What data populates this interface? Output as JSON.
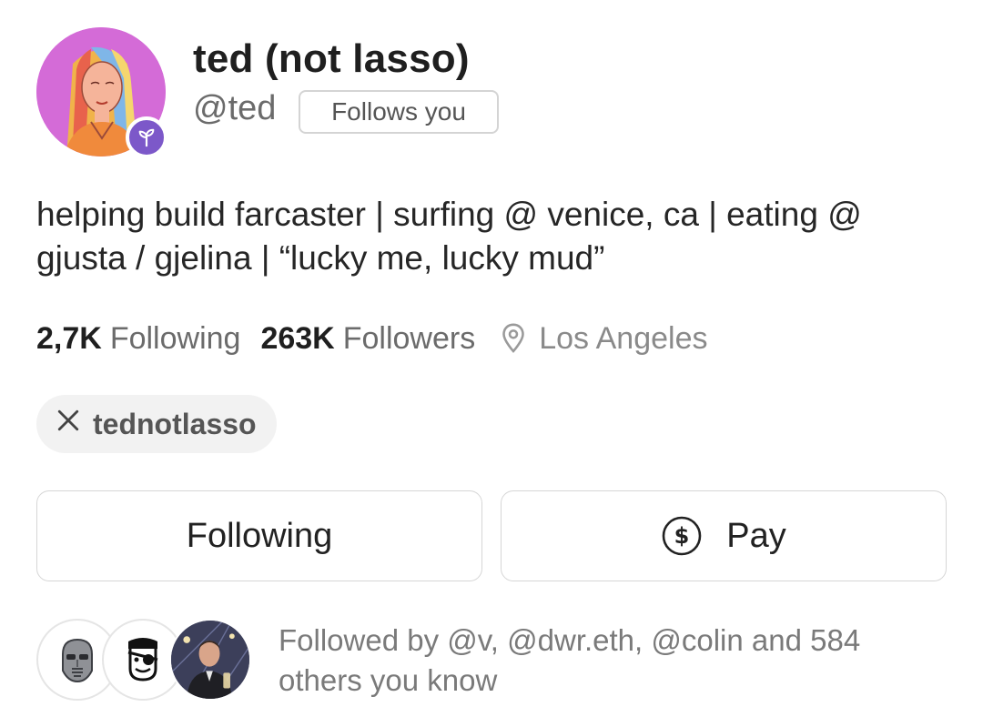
{
  "profile": {
    "display_name": "ted (not lasso)",
    "handle": "@ted",
    "follows_you_label": "Follows you",
    "avatar_icon": "illustrated-woman-avatar",
    "badge_icon": "sprout-icon",
    "bio": "helping build farcaster | surfing @ venice, ca | eating @ gjusta / gjelina | “lucky me, lucky mud”"
  },
  "stats": {
    "following_count": "2,7K",
    "following_label": "Following",
    "followers_count": "263K",
    "followers_label": "Followers",
    "location": "Los Angeles",
    "location_icon": "map-pin-icon"
  },
  "x_link": {
    "icon": "x-logo-icon",
    "glyph": "𝕏",
    "username": "tednotlasso"
  },
  "actions": {
    "following_button": "Following",
    "pay_button": "Pay",
    "pay_icon": "dollar-circle-icon"
  },
  "mutuals": {
    "text": "Followed by @v, @dwr.eth, @colin and 584 others you know",
    "avatars": [
      "metal-mask-avatar",
      "pirate-face-avatar",
      "person-photo-avatar"
    ]
  },
  "colors": {
    "avatar_bg": "#d46bd7",
    "badge_bg": "#7c58c9",
    "muted_text": "#6b6b6b",
    "border": "#d6d6d6",
    "chip_bg": "#f2f2f2"
  }
}
